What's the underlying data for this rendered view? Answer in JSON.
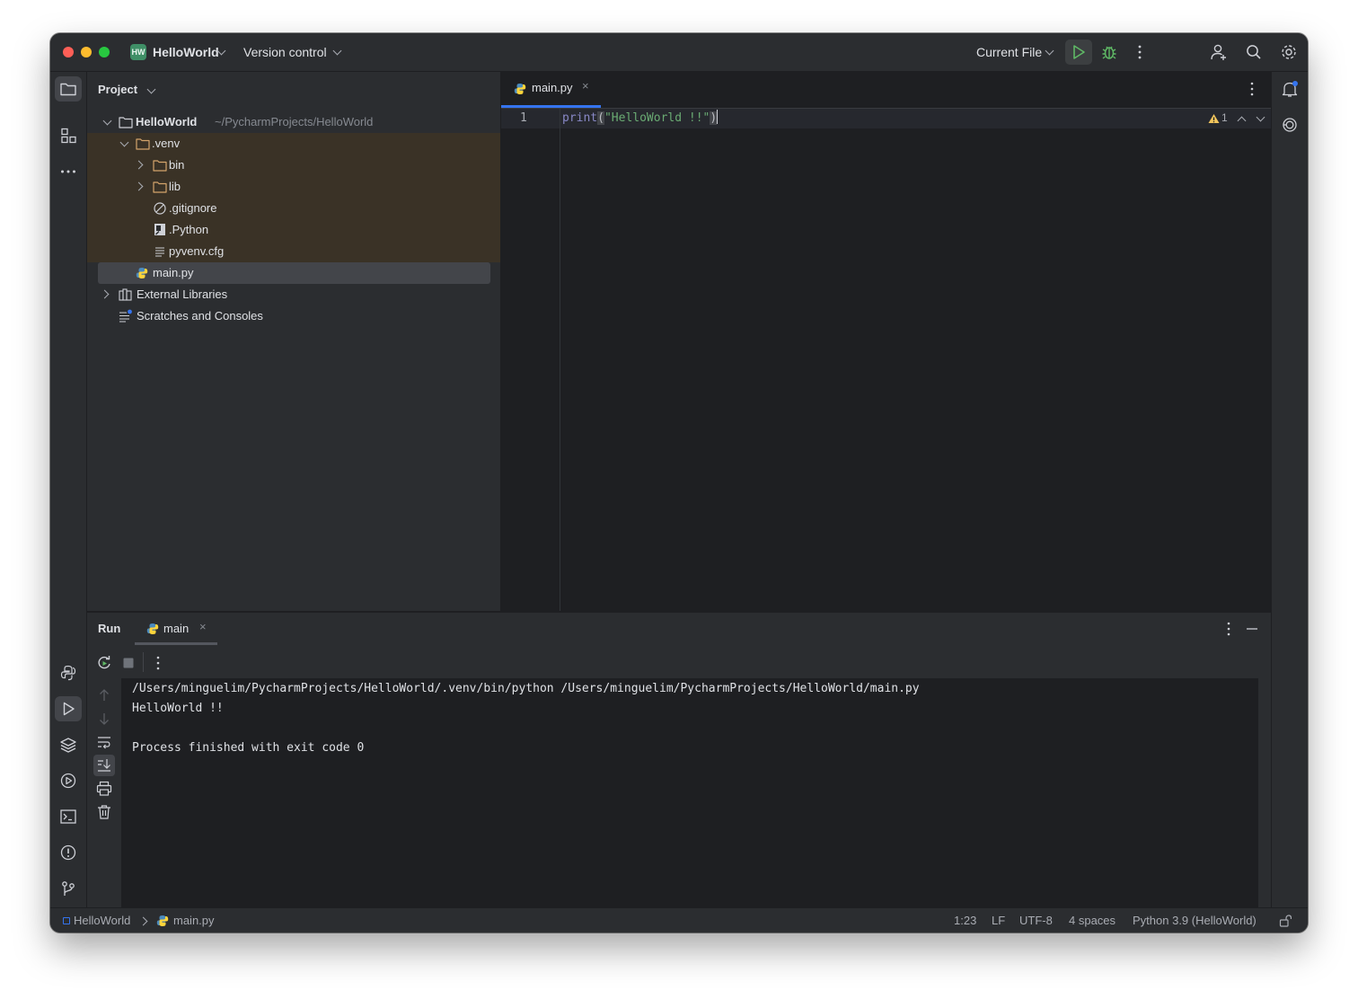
{
  "titlebar": {
    "project_badge": "HW",
    "project_name": "HelloWorld",
    "vcs_label": "Version control",
    "run_config": "Current File"
  },
  "project_panel": {
    "title": "Project",
    "tree": {
      "root_name": "HelloWorld",
      "root_path": "~/PycharmProjects/HelloWorld",
      "venv": ".venv",
      "bin": "bin",
      "lib": "lib",
      "gitignore": ".gitignore",
      "python_link": ".Python",
      "pyvenv": "pyvenv.cfg",
      "main": "main.py",
      "external": "External Libraries",
      "scratches": "Scratches and Consoles"
    }
  },
  "editor": {
    "tab_label": "main.py",
    "line_number": "1",
    "code": {
      "func": "print",
      "open_paren": "(",
      "string": "\"HelloWorld !!\"",
      "close_paren": ")"
    },
    "warning_count": "1"
  },
  "run_panel": {
    "title": "Run",
    "tab_label": "main",
    "console": {
      "line1": "/Users/minguelim/PycharmProjects/HelloWorld/.venv/bin/python /Users/minguelim/PycharmProjects/HelloWorld/main.py",
      "line2": "HelloWorld !!",
      "line3": "",
      "line4": "Process finished with exit code 0"
    }
  },
  "statusbar": {
    "breadcrumb_project": "HelloWorld",
    "breadcrumb_file": "main.py",
    "position": "1:23",
    "line_sep": "LF",
    "encoding": "UTF-8",
    "indent": "4 spaces",
    "interpreter": "Python 3.9 (HelloWorld)"
  },
  "colors": {
    "accent": "#3574f0",
    "run_green": "#5fb865",
    "string_green": "#6aab73",
    "keyword_blue": "#8888c6",
    "warning_yellow": "#f2c55c"
  }
}
